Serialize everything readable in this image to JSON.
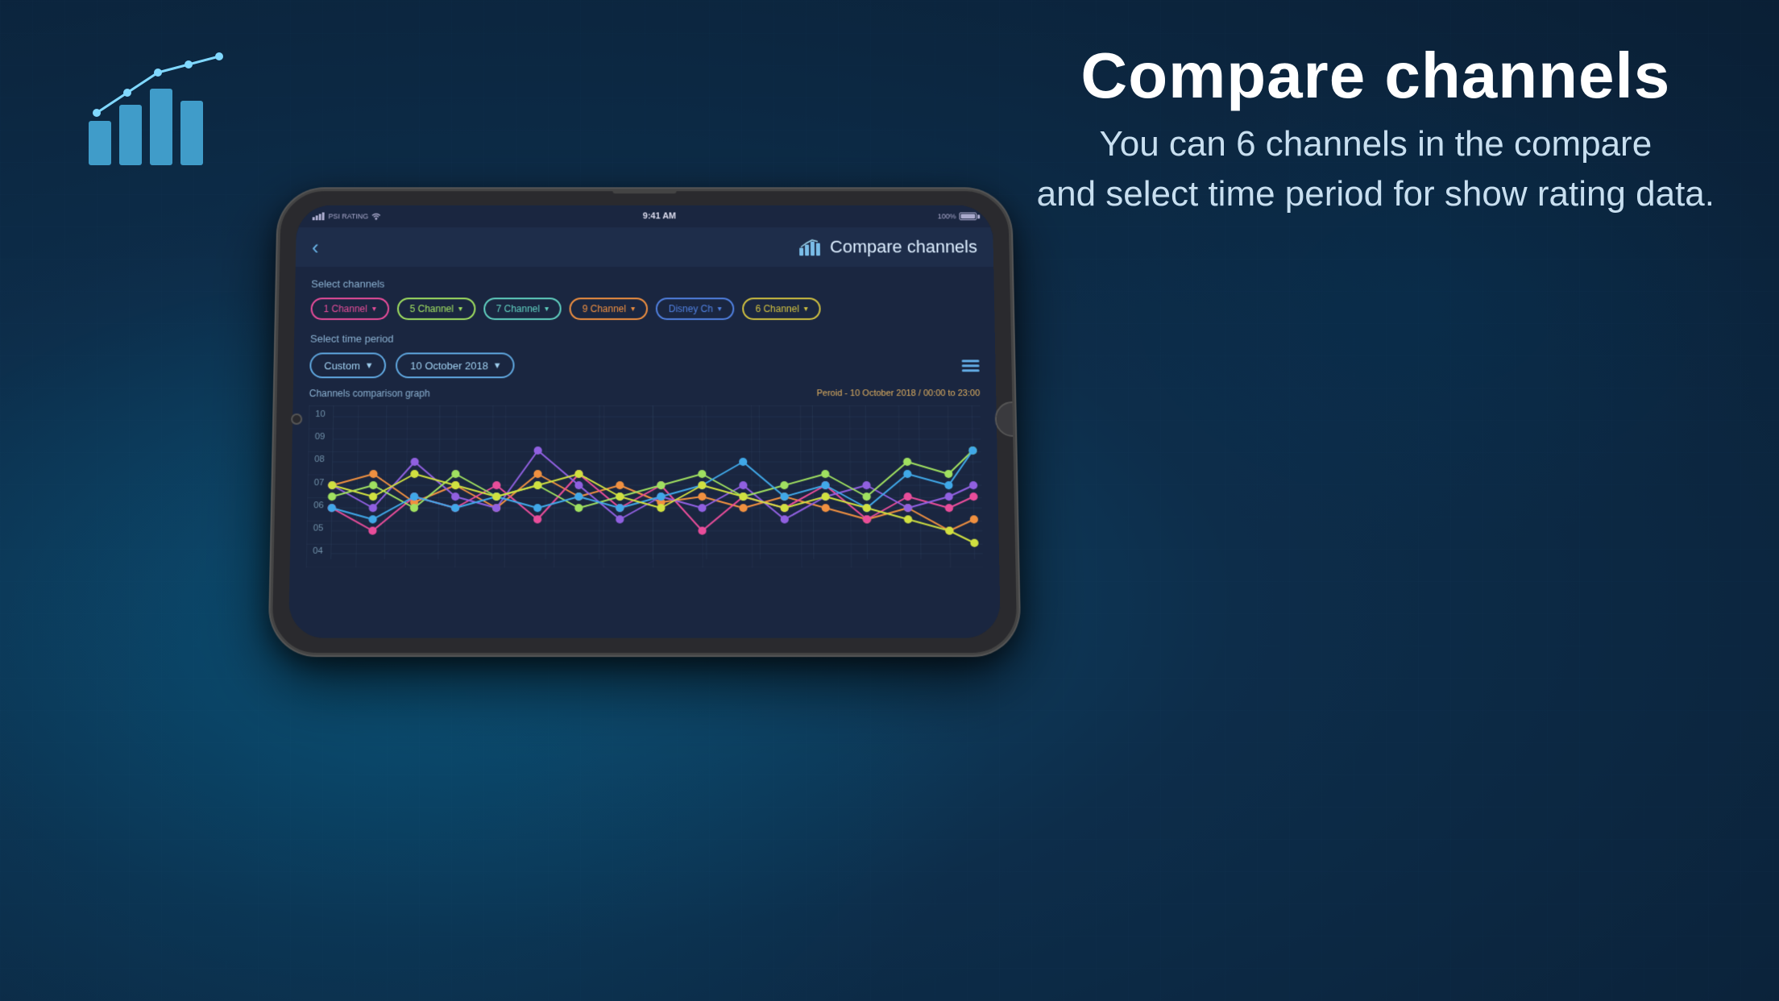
{
  "background": {
    "color": "#1a3a5c"
  },
  "hero": {
    "title": "Compare channels",
    "subtitle_line1": "You can 6 channels in the compare",
    "subtitle_line2": "and select time period for show rating data."
  },
  "status_bar": {
    "carrier": "PSI RATING",
    "time": "9:41 AM",
    "battery": "100%",
    "signal_icon": "signal-icon",
    "wifi_icon": "wifi-icon",
    "battery_icon": "battery-icon"
  },
  "app_header": {
    "back_label": "‹",
    "title": "Compare channels",
    "icon": "chart-icon"
  },
  "select_channels_label": "Select channels",
  "channels": [
    {
      "label": "1 Channel",
      "color": "pink"
    },
    {
      "label": "5 Channel",
      "color": "green"
    },
    {
      "label": "7 Channel",
      "color": "cyan"
    },
    {
      "label": "9 Channel",
      "color": "orange"
    },
    {
      "label": "Disney Ch",
      "color": "blue"
    },
    {
      "label": "6 Channel",
      "color": "yellow"
    }
  ],
  "select_time_period_label": "Select time period",
  "time_period": {
    "type": "Custom",
    "date": "10 October 2018"
  },
  "graph": {
    "label": "Channels comparison graph",
    "period_label": "Peroid - 10 October 2018 / 00:00 to 23:00",
    "y_axis": [
      "10",
      "09",
      "08",
      "07",
      "06",
      "05",
      "04"
    ],
    "colors": {
      "pink": "#e84d9a",
      "green": "#a0e060",
      "cyan": "#60c8a0",
      "orange": "#f09040",
      "blue": "#40a8e8",
      "purple": "#9060e0"
    }
  },
  "menu_icon": "hamburger-icon"
}
